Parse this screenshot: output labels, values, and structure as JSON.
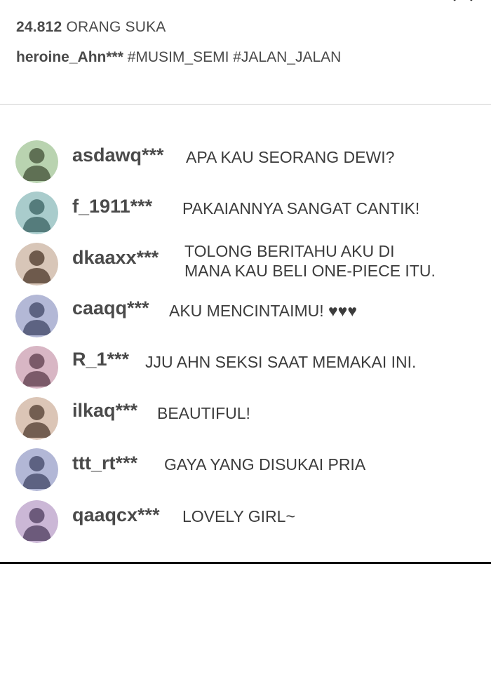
{
  "post": {
    "likes_count": "24.812",
    "likes_label": "ORANG SUKA",
    "caption_user": "heroine_Ahn***",
    "caption_text": "#MUSIM_SEMI #JALAN_JALAN"
  },
  "comments": [
    {
      "user": "asdawq***",
      "text": "APA KAU SEORANG DEWI?",
      "bg": "#b9d3b0",
      "fg": "#5f7054"
    },
    {
      "user": "f_1911***",
      "text": "PAKAIANNYA SANGAT CANTIK!",
      "bg": "#a9cccc",
      "fg": "#557c7c"
    },
    {
      "user": "dkaaxx***",
      "text": "TOLONG BERITAHU AKU DI\nMANA KAU BELI ONE-PIECE ITU.",
      "bg": "#d8c6b8",
      "fg": "#6e5a4c"
    },
    {
      "user": "caaqq***",
      "text": "AKU MENCINTAIMU! ♥♥♥",
      "bg": "#b3b8d6",
      "fg": "#5d6382"
    },
    {
      "user": "R_1***",
      "text": "JJU AHN SEKSI SAAT MEMAKAI INI.",
      "bg": "#d8b6c4",
      "fg": "#7b5a69"
    },
    {
      "user": "ilkaq***",
      "text": "BEAUTIFUL!",
      "bg": "#dbc5b6",
      "fg": "#735e51"
    },
    {
      "user": "ttt_rt***",
      "text": "GAYA YANG DISUKAI PRIA",
      "bg": "#b2b7d6",
      "fg": "#5d6282"
    },
    {
      "user": "qaaqcx***",
      "text": "LOVELY GIRL~",
      "bg": "#cbb7d6",
      "fg": "#6c5a7b"
    }
  ]
}
